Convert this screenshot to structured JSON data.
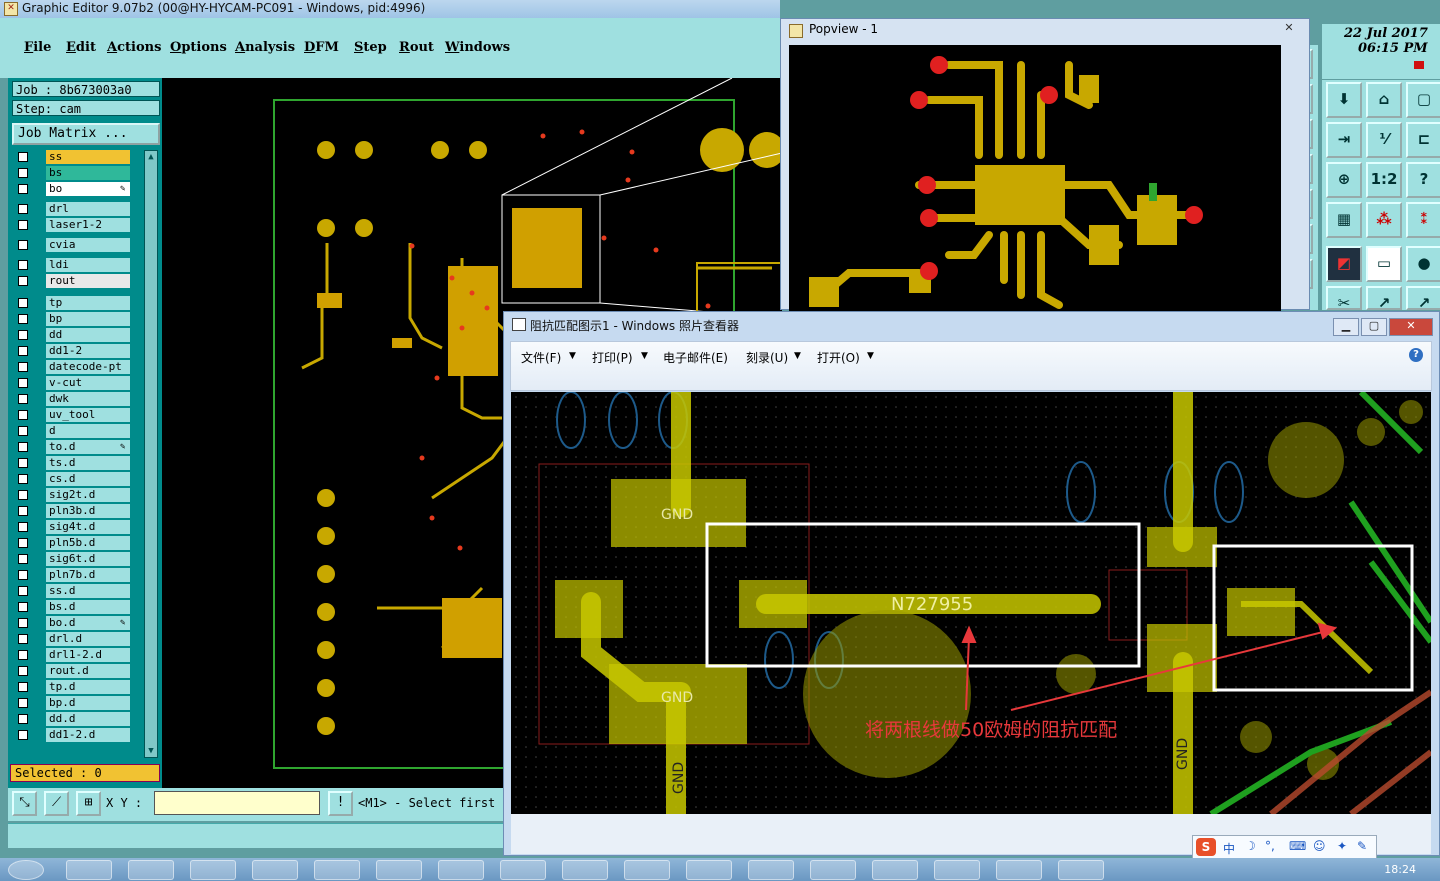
{
  "main_window": {
    "title": "Graphic Editor 9.07b2 (00@HY-HYCAM-PC091 - Windows, pid:4996)",
    "menu": [
      "File",
      "Edit",
      "Actions",
      "Options",
      "Analysis",
      "DFM",
      "Step",
      "Rout",
      "Windows"
    ],
    "job": "Job  : 8b673003a0",
    "step": "Step: cam",
    "job_matrix": "Job Matrix ...",
    "layers": [
      "ss",
      "bs",
      "bo",
      "drl",
      "laser1-2",
      "cvia",
      "ldi",
      "rout",
      "tp",
      "bp",
      "dd",
      "dd1-2",
      "datecode-pt",
      "v-cut",
      "dwk",
      "uv_tool",
      "d",
      "to.d",
      "ts.d",
      "cs.d",
      "sig2t.d",
      "pln3b.d",
      "sig4t.d",
      "pln5b.d",
      "sig6t.d",
      "pln7b.d",
      "ss.d",
      "bs.d",
      "bo.d",
      "drl.d",
      "drl1-2.d",
      "rout.d",
      "tp.d",
      "bp.d",
      "dd.d",
      "dd1-2.d"
    ],
    "selected": "Selected : 0",
    "xy_label": "X Y :",
    "command_value": "",
    "message": "<M1> - Select first"
  },
  "datetime": {
    "date": "22 Jul 2017",
    "time": "06:15 PM"
  },
  "popview": {
    "title": "Popview - 1",
    "close": "✕"
  },
  "photo_viewer": {
    "title": "阻抗匹配图示1 - Windows 照片查看器",
    "menu": [
      "文件(F)",
      "打印(P)",
      "电子邮件(E)",
      "刻录(U)",
      "打开(O)"
    ],
    "help": "?",
    "image_labels": {
      "net": "N727955",
      "gnd": "GND",
      "annotation": "将两根线做50欧姆的阻抗匹配"
    }
  },
  "ime": {
    "mode": "中"
  },
  "taskbar": {
    "clock": "18:24"
  },
  "colors": {
    "pcb_copper": "#c8b400",
    "pcb_pad": "#e6c21e",
    "trace_highlight": "#e02020",
    "cyan_panel": "#9fe0e0",
    "annotation_red": "#e8383b"
  }
}
